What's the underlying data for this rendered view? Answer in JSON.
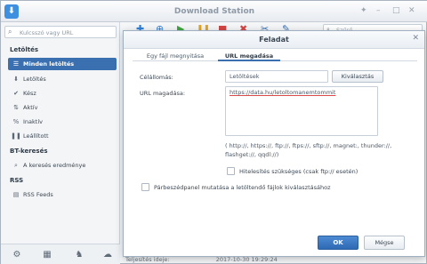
{
  "app": {
    "title": "Download Station",
    "logo_glyph": "⬇"
  },
  "window_controls": {
    "pin": "✦",
    "minimize": "–",
    "maximize": "□",
    "close": "✕"
  },
  "sidebar": {
    "search_placeholder": "Kulcsszó vagy URL",
    "sections": [
      {
        "label": "Letöltés"
      },
      {
        "label": "BT-keresés"
      },
      {
        "label": "RSS"
      }
    ],
    "items": [
      {
        "label": "Minden letöltés",
        "icon": "list-icon",
        "glyph": "☰",
        "active": true
      },
      {
        "label": "Letöltés",
        "icon": "download-icon",
        "glyph": "⬇",
        "active": false
      },
      {
        "label": "Kész",
        "icon": "check-icon",
        "glyph": "✔",
        "active": false
      },
      {
        "label": "Aktív",
        "icon": "active-arrows-icon",
        "glyph": "⇅",
        "active": false
      },
      {
        "label": "Inaktív",
        "icon": "percent-icon",
        "glyph": "%",
        "active": false
      },
      {
        "label": "Leállított",
        "icon": "pause-icon",
        "glyph": "❚❚",
        "active": false
      },
      {
        "label": "A keresés eredménye",
        "icon": "search-icon",
        "glyph": "⌕",
        "active": false
      },
      {
        "label": "RSS Feeds",
        "icon": "rss-icon",
        "glyph": "▤",
        "active": false
      }
    ],
    "bottom_icons": [
      {
        "name": "settings-icon",
        "glyph": "⚙"
      },
      {
        "name": "scheduler-icon",
        "glyph": "▦"
      },
      {
        "name": "emule-icon",
        "glyph": "♞"
      },
      {
        "name": "cloud-icon",
        "glyph": "☁"
      }
    ]
  },
  "toolbar": {
    "icons": [
      {
        "name": "add-icon",
        "glyph": "✚",
        "color": "#2f7fd6"
      },
      {
        "name": "add-url-icon",
        "glyph": "⊕",
        "color": "#2f7fd6"
      },
      {
        "name": "resume-icon",
        "glyph": "▶",
        "color": "#3fa63f"
      },
      {
        "name": "pause-icon",
        "glyph": "❚❚",
        "color": "#e6a417"
      },
      {
        "name": "stop-icon",
        "glyph": "■",
        "color": "#d24545"
      },
      {
        "name": "delete-icon",
        "glyph": "✖",
        "color": "#d24545"
      },
      {
        "name": "clean-icon",
        "glyph": "✂",
        "color": "#3a6fb0"
      },
      {
        "name": "edit-icon",
        "glyph": "✎",
        "color": "#3a6fb0"
      }
    ],
    "search_placeholder": "Szűrő"
  },
  "status_bar": {
    "label": "Teljesítés ideje:",
    "value": "2017-10-30 19:29:24"
  },
  "dialog": {
    "title": "Feladat",
    "tabs": [
      {
        "label": "Egy fájl megnyitása",
        "active": false
      },
      {
        "label": "URL megadása",
        "active": true
      }
    ],
    "destination_label": "Célállomás:",
    "destination_value": "Letöltések",
    "browse_label": "Kiválasztás",
    "url_label": "URL magadása:",
    "url_value": "https://data.hu/letoltomanemtommit",
    "supported_protocols": "( http://, https://, ftp://, ftps://, sftp://, magnet:, thunder://, flashget://, qqdl://)",
    "auth_checkbox_label": "Hitelesítés szükséges (csak ftp:// esetén)",
    "auth_checked": false,
    "dialog_checkbox_label": "Párbeszédpanel mutatása a letöltendő fájlok kiválasztásához",
    "dialog_checked": false,
    "ok_label": "OK",
    "cancel_label": "Mégse"
  }
}
